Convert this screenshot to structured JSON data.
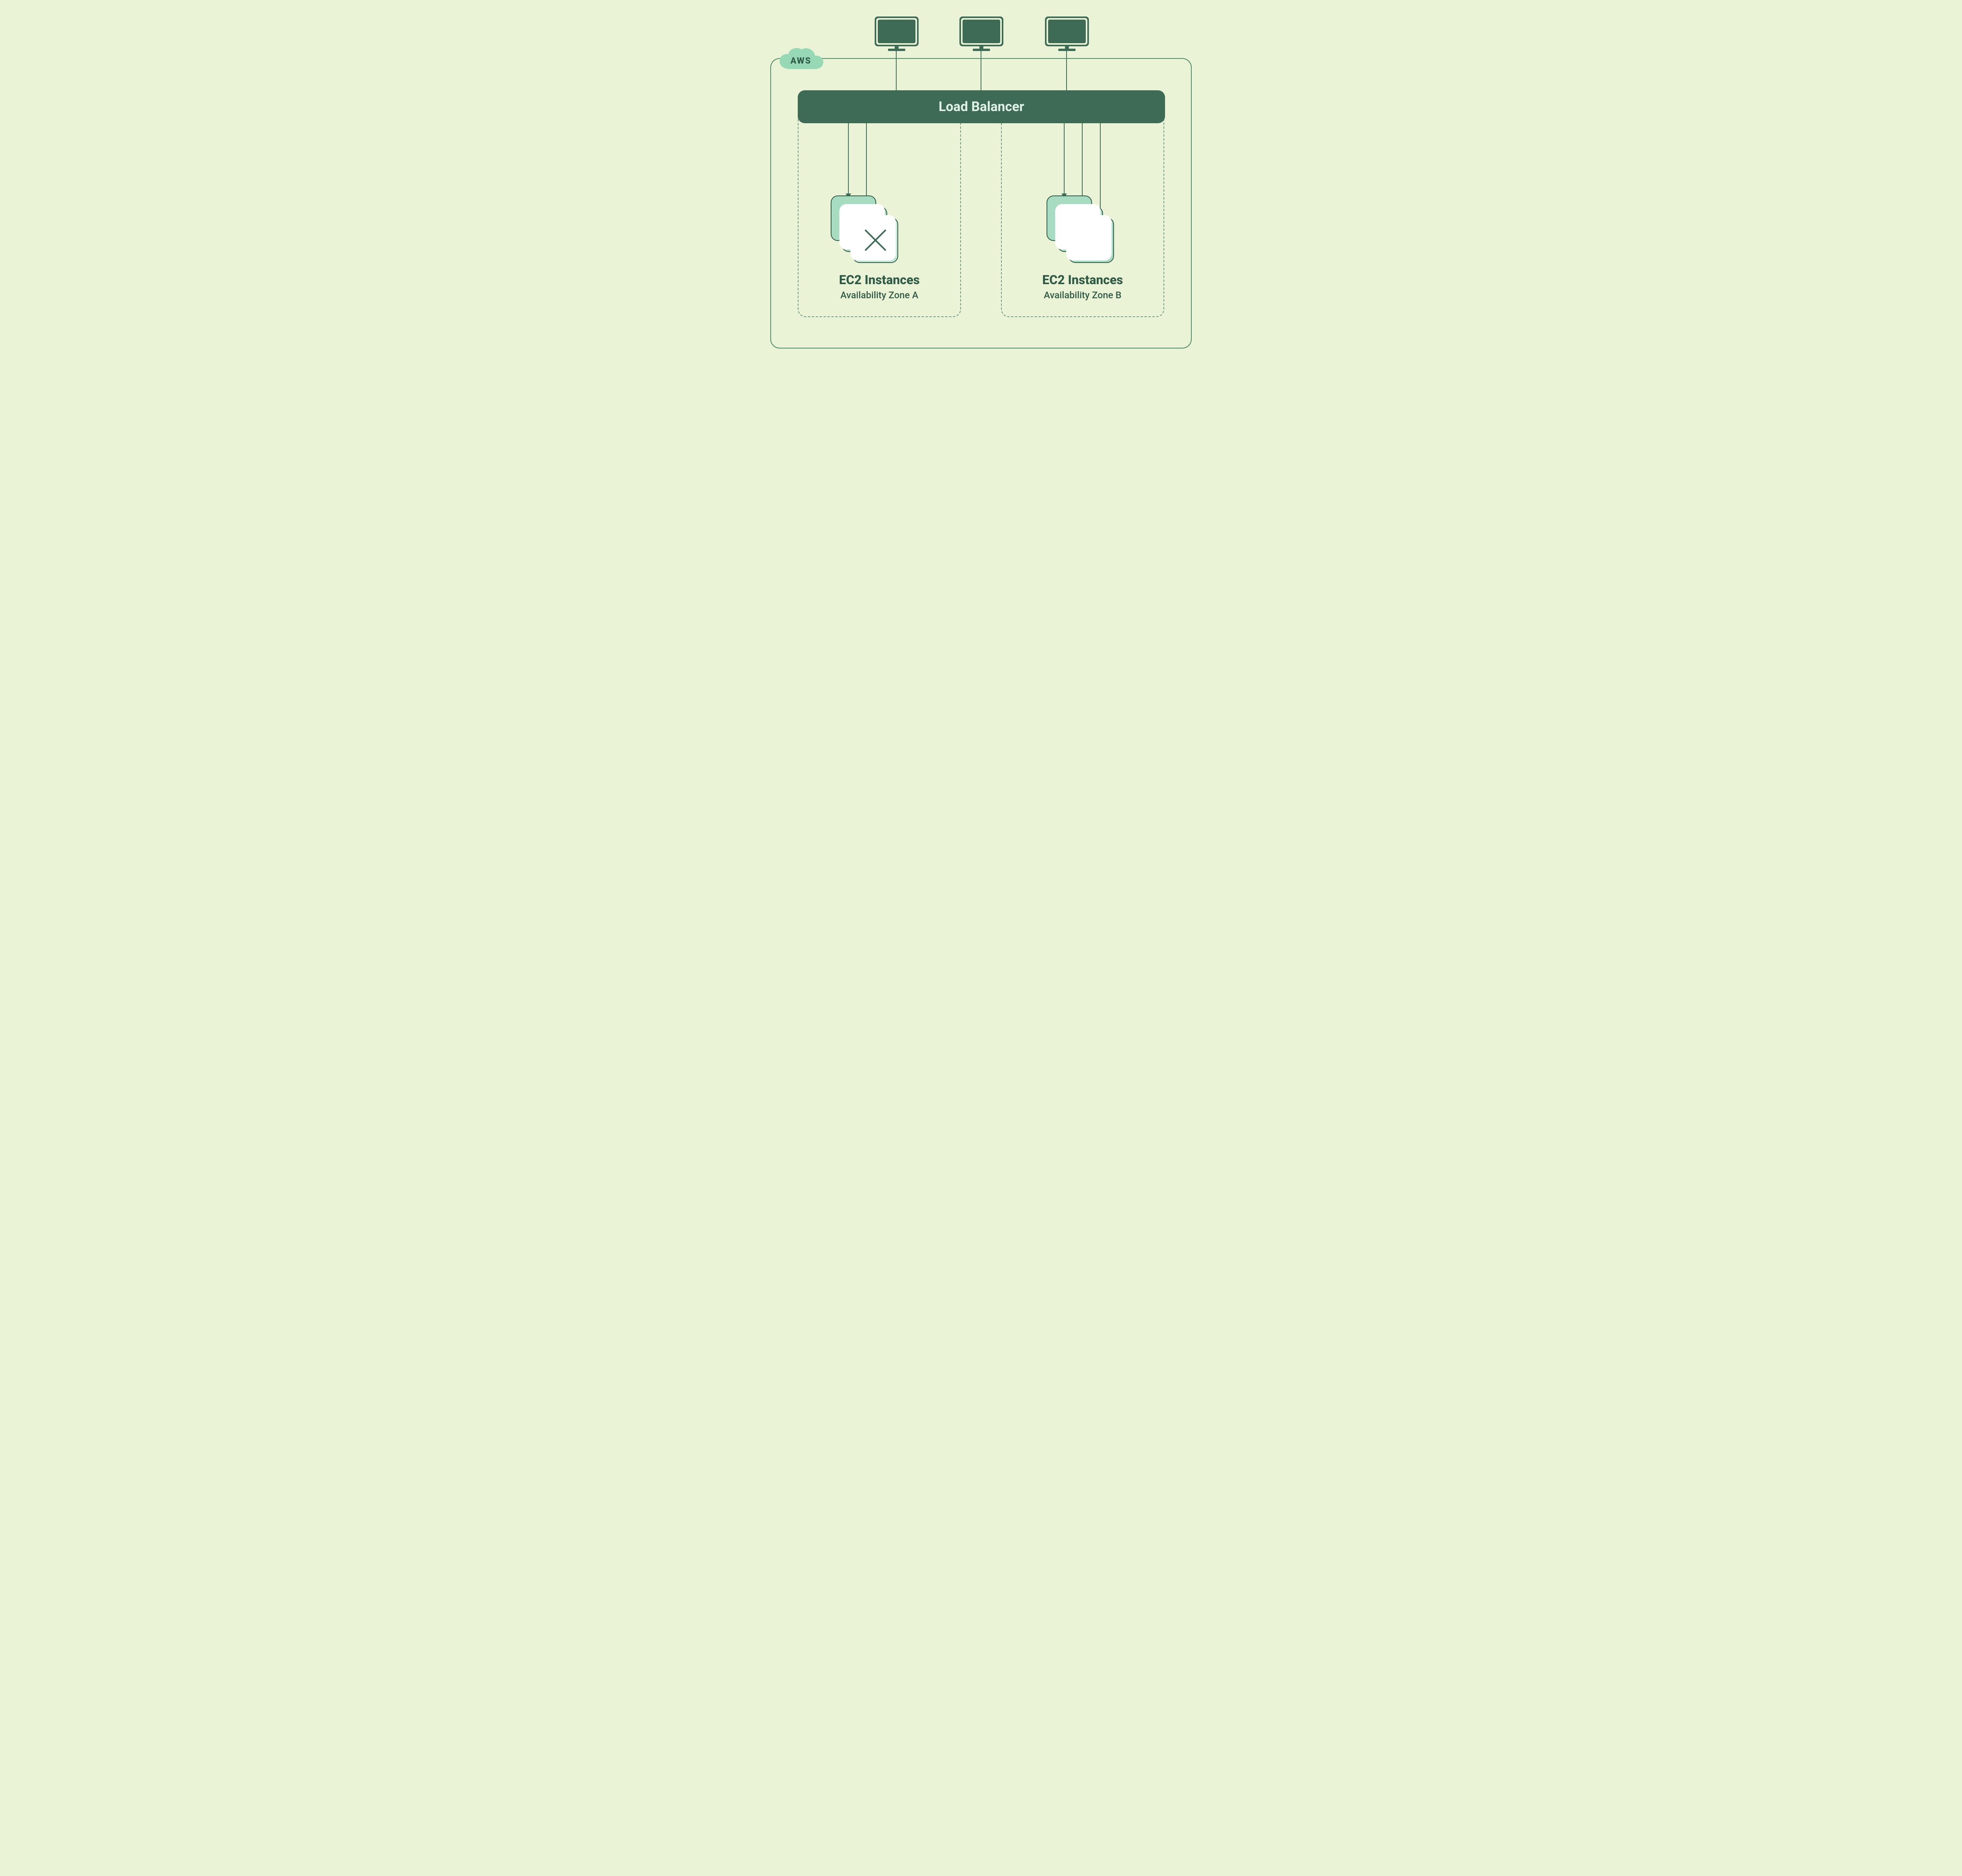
{
  "cloud": {
    "label": "AWS"
  },
  "load_balancer": {
    "label": "Load Balancer"
  },
  "zones": {
    "a": {
      "title": "EC2 Instances",
      "subtitle": "Availability Zone A",
      "instance_count": 3,
      "failed_instance": true,
      "arrows_from_lb": 2
    },
    "b": {
      "title": "EC2 Instances",
      "subtitle": "Availability Zone B",
      "instance_count": 3,
      "failed_instance": false,
      "arrows_from_lb": 3
    }
  },
  "clients": {
    "count": 3,
    "icon": "monitor-icon"
  },
  "colors": {
    "background": "#ebf3d6",
    "primary_dark": "#3d6b56",
    "accent_fill": "#a8dcc0",
    "border": "#4d8a6a"
  }
}
